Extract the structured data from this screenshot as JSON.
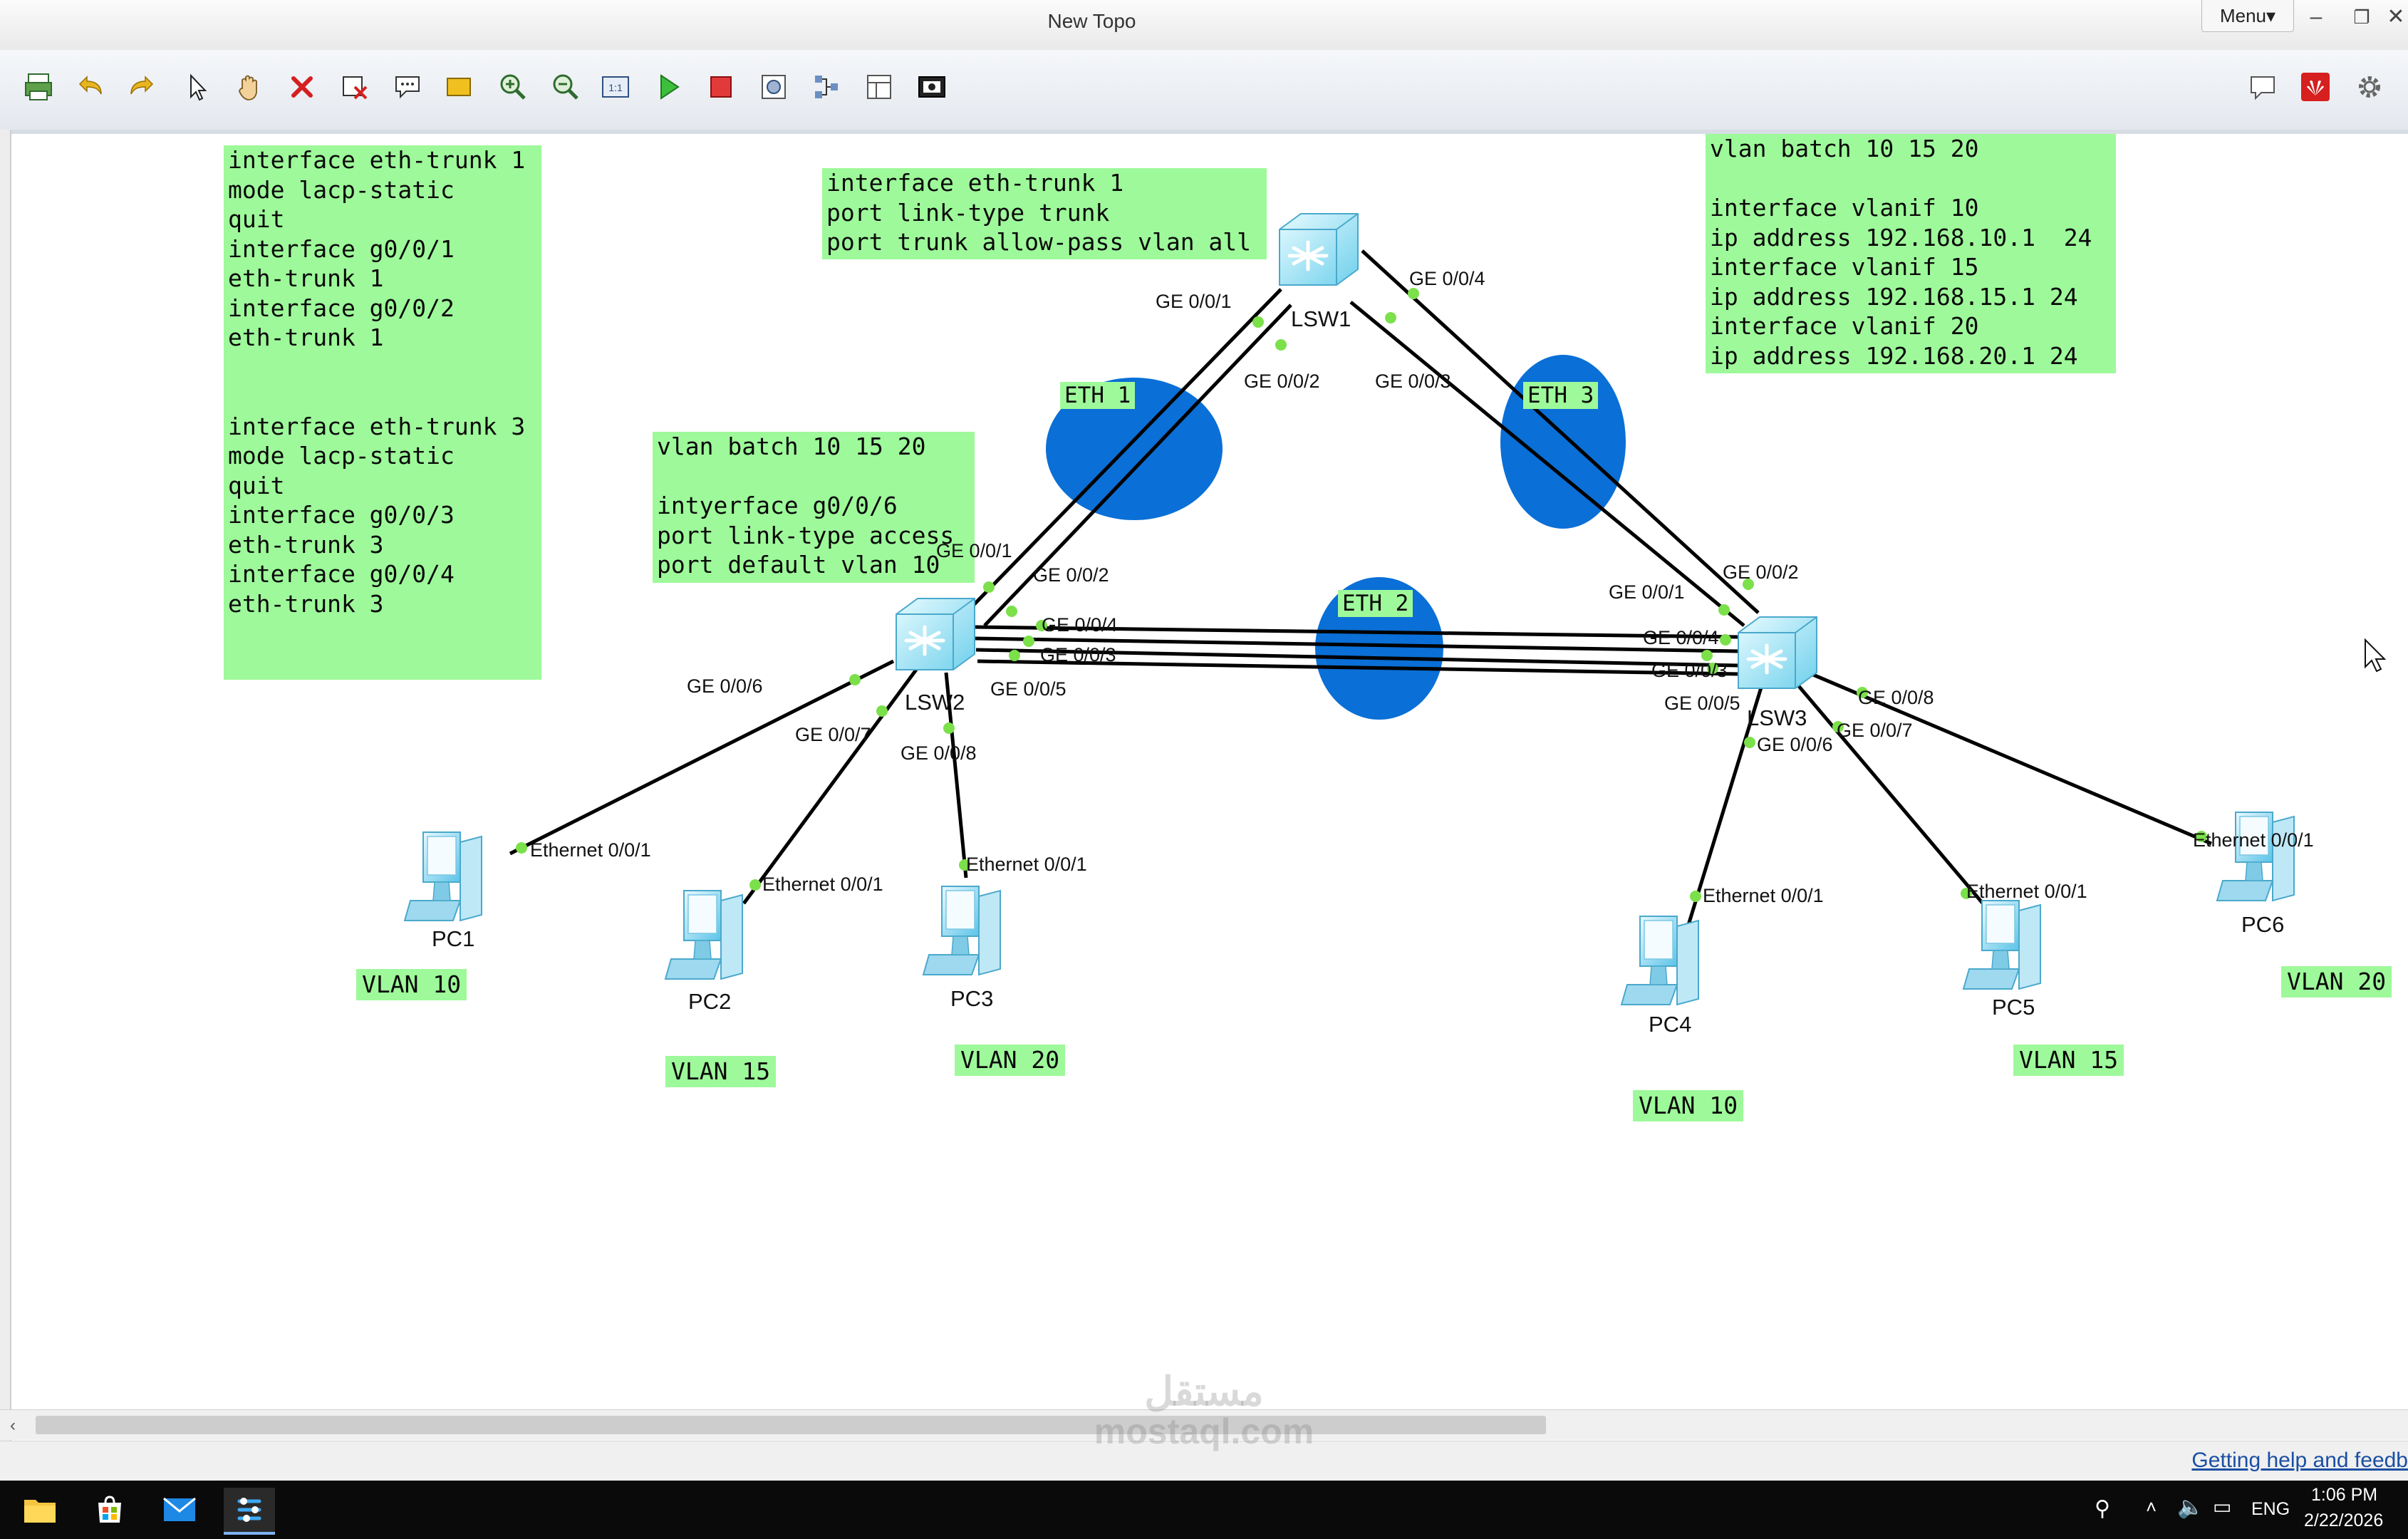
{
  "window": {
    "title": "New Topo",
    "menu_label": "Menu▾"
  },
  "toolbar_icons": [
    "print-icon",
    "undo-icon",
    "redo-icon",
    "pointer-icon",
    "hand-icon",
    "delete-icon",
    "clear-icon",
    "text-note-icon",
    "rectangle-icon",
    "zoom-in-icon",
    "zoom-out-icon",
    "fit-icon",
    "start-icon",
    "stop-icon",
    "capture-icon",
    "topology-icon",
    "palette-icon",
    "screenshot-icon"
  ],
  "config_boxes": {
    "trunk_lacp": "interface eth-trunk 1\nmode lacp-static\nquit\ninterface g0/0/1\neth-trunk 1\ninterface g0/0/2\neth-trunk 1\n\n\ninterface eth-trunk 3\nmode lacp-static\nquit\ninterface g0/0/3\neth-trunk 3\ninterface g0/0/4\neth-trunk 3",
    "trunk_allow": "interface eth-trunk 1\nport link-type trunk\nport trunk allow-pass vlan all",
    "access_vlan": "vlan batch 10 15 20\n\nintyerface g0/0/6\nport link-type access\nport default vlan 10",
    "vlanif": "vlan batch 10 15 20\n\ninterface vlanif 10\nip address 192.168.10.1  24\ninterface vlanif 15\nip address 192.168.15.1 24\ninterface vlanif 20\nip address 192.168.20.1 24"
  },
  "switches": {
    "lsw1": "LSW1",
    "lsw2": "LSW2",
    "lsw3": "LSW3"
  },
  "pcs": {
    "pc1": "PC1",
    "pc2": "PC2",
    "pc3": "PC3",
    "pc4": "PC4",
    "pc5": "PC5",
    "pc6": "PC6"
  },
  "trunks": {
    "eth1": "ETH 1",
    "eth2": "ETH 2",
    "eth3": "ETH 3"
  },
  "ports": {
    "lsw1_g1": "GE 0/0/1",
    "lsw1_g2": "GE 0/0/2",
    "lsw1_g3": "GE 0/0/3",
    "lsw1_g4": "GE 0/0/4",
    "lsw2_g1": "GE 0/0/1",
    "lsw2_g2": "GE 0/0/2",
    "lsw2_g3": "GE 0/0/3",
    "lsw2_g4": "GE 0/0/4",
    "lsw2_g5": "GE 0/0/5",
    "lsw2_g6": "GE 0/0/6",
    "lsw2_g7": "GE 0/0/7",
    "lsw2_g8": "GE 0/0/8",
    "lsw3_g1": "GE 0/0/1",
    "lsw3_g2": "GE 0/0/2",
    "lsw3_g3": "GE 0/0/3",
    "lsw3_g4": "GE 0/0/4",
    "lsw3_g5": "GE 0/0/5",
    "lsw3_g6": "GE 0/0/6",
    "lsw3_g7": "GE 0/0/7",
    "lsw3_g8": "GE 0/0/8",
    "pc1_eth": "Ethernet 0/0/1",
    "pc2_eth": "Ethernet 0/0/1",
    "pc3_eth": "Ethernet 0/0/1",
    "pc4_eth": "Ethernet 0/0/1",
    "pc5_eth": "Ethernet 0/0/1",
    "pc6_eth": "Ethernet 0/0/1"
  },
  "vlan_tags": {
    "pc1": "VLAN 10",
    "pc2": "VLAN 15",
    "pc3": "VLAN 20",
    "pc4": "VLAN 10",
    "pc5": "VLAN 15",
    "pc6": "VLAN 20"
  },
  "status": {
    "help": "Getting help and feedb"
  },
  "taskbar": {
    "lang": "ENG",
    "time": "1:06 PM",
    "date": "2/22/2026"
  },
  "watermark": {
    "line1": "مستقل",
    "line2": "mostaql.com"
  },
  "colors": {
    "config_bg": "#9ef99a",
    "trunk_ellipse": "#0a6fd6",
    "port_dot": "#7be04a"
  }
}
